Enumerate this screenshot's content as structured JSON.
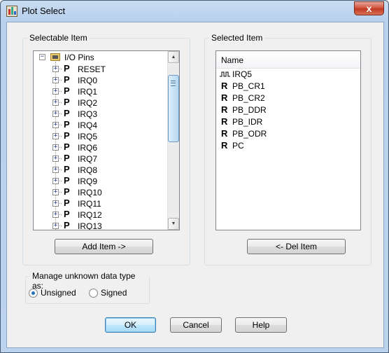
{
  "window": {
    "title": "Plot Select",
    "close_label": "x"
  },
  "selectable": {
    "group_label": "Selectable Item",
    "root": {
      "label": "I/O Pins",
      "expander": "−",
      "icon": "folder-icon"
    },
    "items": [
      {
        "label": "RESET",
        "type": "P"
      },
      {
        "label": "IRQ0",
        "type": "P"
      },
      {
        "label": "IRQ1",
        "type": "P"
      },
      {
        "label": "IRQ2",
        "type": "P"
      },
      {
        "label": "IRQ3",
        "type": "P"
      },
      {
        "label": "IRQ4",
        "type": "P"
      },
      {
        "label": "IRQ5",
        "type": "P"
      },
      {
        "label": "IRQ6",
        "type": "P"
      },
      {
        "label": "IRQ7",
        "type": "P"
      },
      {
        "label": "IRQ8",
        "type": "P"
      },
      {
        "label": "IRQ9",
        "type": "P"
      },
      {
        "label": "IRQ10",
        "type": "P"
      },
      {
        "label": "IRQ11",
        "type": "P"
      },
      {
        "label": "IRQ12",
        "type": "P"
      },
      {
        "label": "IRQ13",
        "type": "P"
      }
    ],
    "expander_symbol": "+",
    "add_button": "Add Item ->"
  },
  "selected": {
    "group_label": "Selected Item",
    "column_header": "Name",
    "items": [
      {
        "label": "IRQ5",
        "type": "wave"
      },
      {
        "label": "PB_CR1",
        "type": "R"
      },
      {
        "label": "PB_CR2",
        "type": "R"
      },
      {
        "label": "PB_DDR",
        "type": "R"
      },
      {
        "label": "PB_IDR",
        "type": "R"
      },
      {
        "label": "PB_ODR",
        "type": "R"
      },
      {
        "label": "PC",
        "type": "R"
      }
    ],
    "del_button": "<- Del Item"
  },
  "unknown_type": {
    "group_label": "Manage unknown data type as:",
    "options": [
      {
        "label": "Unsigned",
        "checked": true
      },
      {
        "label": "Signed",
        "checked": false
      }
    ]
  },
  "footer": {
    "ok": "OK",
    "cancel": "Cancel",
    "help": "Help"
  },
  "scrollbar": {
    "up_arrow": "▲",
    "down_arrow": "▼"
  }
}
